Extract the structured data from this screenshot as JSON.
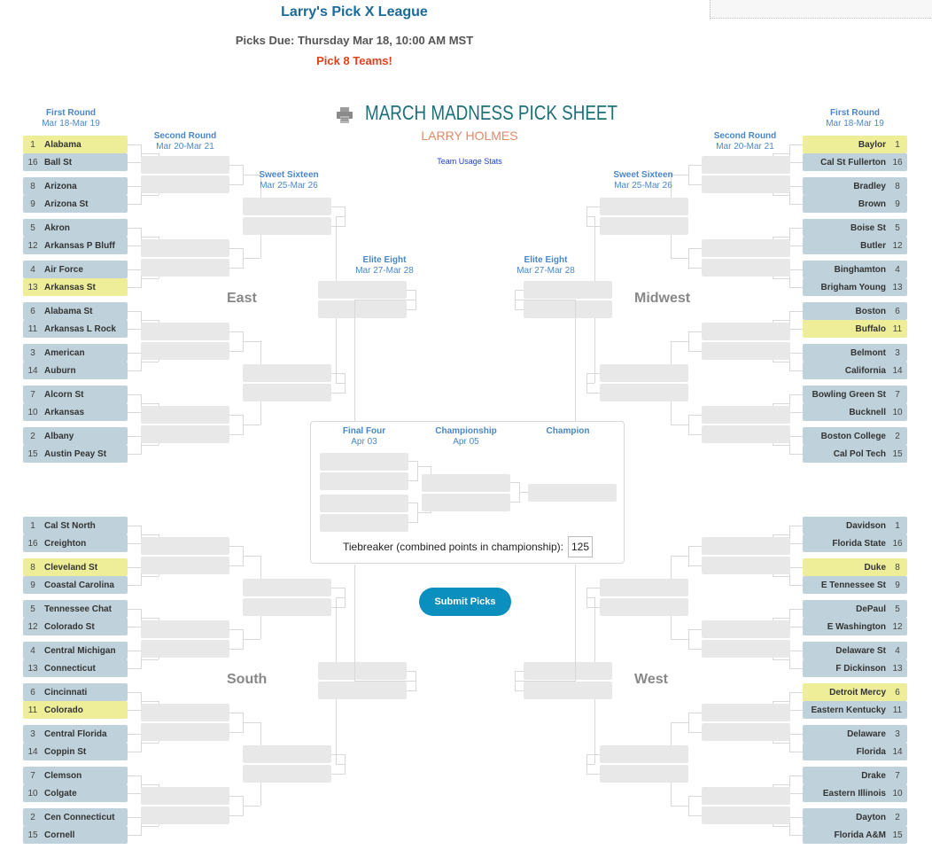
{
  "header": {
    "league_title": "Larry's Pick X League",
    "picks_due": "Picks Due: Thursday Mar 18, 10:00 AM MST",
    "pick_count": "Pick 8 Teams!",
    "sheet_title": "MARCH MADNESS PICK SHEET",
    "player_name": "LARRY HOLMES",
    "team_usage_link": "Team Usage Stats",
    "print_icon": "printer-icon"
  },
  "rounds": {
    "first": {
      "name": "First Round",
      "dates": "Mar 18-Mar 19"
    },
    "second": {
      "name": "Second Round",
      "dates": "Mar 20-Mar 21"
    },
    "sweet16": {
      "name": "Sweet Sixteen",
      "dates": "Mar 25-Mar 26"
    },
    "elite8": {
      "name": "Elite Eight",
      "dates": "Mar 27-Mar 28"
    },
    "final4": {
      "name": "Final Four",
      "dates": "Apr 03"
    },
    "championship": {
      "name": "Championship",
      "dates": "Apr 05"
    },
    "champion": {
      "name": "Champion"
    }
  },
  "regions": [
    {
      "name": "East",
      "side": "left",
      "teams": [
        {
          "seed": 1,
          "name": "Alabama",
          "picked": true
        },
        {
          "seed": 16,
          "name": "Ball St",
          "picked": false
        },
        {
          "seed": 8,
          "name": "Arizona",
          "picked": false
        },
        {
          "seed": 9,
          "name": "Arizona St",
          "picked": false
        },
        {
          "seed": 5,
          "name": "Akron",
          "picked": false
        },
        {
          "seed": 12,
          "name": "Arkansas P Bluff",
          "picked": false
        },
        {
          "seed": 4,
          "name": "Air Force",
          "picked": false
        },
        {
          "seed": 13,
          "name": "Arkansas St",
          "picked": true
        },
        {
          "seed": 6,
          "name": "Alabama St",
          "picked": false
        },
        {
          "seed": 11,
          "name": "Arkansas L Rock",
          "picked": false
        },
        {
          "seed": 3,
          "name": "American",
          "picked": false
        },
        {
          "seed": 14,
          "name": "Auburn",
          "picked": false
        },
        {
          "seed": 7,
          "name": "Alcorn St",
          "picked": false
        },
        {
          "seed": 10,
          "name": "Arkansas",
          "picked": false
        },
        {
          "seed": 2,
          "name": "Albany",
          "picked": false
        },
        {
          "seed": 15,
          "name": "Austin Peay St",
          "picked": false
        }
      ]
    },
    {
      "name": "Midwest",
      "side": "right",
      "teams": [
        {
          "seed": 1,
          "name": "Baylor",
          "picked": true
        },
        {
          "seed": 16,
          "name": "Cal St Fullerton",
          "picked": false
        },
        {
          "seed": 8,
          "name": "Bradley",
          "picked": false
        },
        {
          "seed": 9,
          "name": "Brown",
          "picked": false
        },
        {
          "seed": 5,
          "name": "Boise St",
          "picked": false
        },
        {
          "seed": 12,
          "name": "Butler",
          "picked": false
        },
        {
          "seed": 4,
          "name": "Binghamton",
          "picked": false
        },
        {
          "seed": 13,
          "name": "Brigham Young",
          "picked": false
        },
        {
          "seed": 6,
          "name": "Boston",
          "picked": false
        },
        {
          "seed": 11,
          "name": "Buffalo",
          "picked": true
        },
        {
          "seed": 3,
          "name": "Belmont",
          "picked": false
        },
        {
          "seed": 14,
          "name": "California",
          "picked": false
        },
        {
          "seed": 7,
          "name": "Bowling Green St",
          "picked": false
        },
        {
          "seed": 10,
          "name": "Bucknell",
          "picked": false
        },
        {
          "seed": 2,
          "name": "Boston College",
          "picked": false
        },
        {
          "seed": 15,
          "name": "Cal Pol Tech",
          "picked": false
        }
      ]
    },
    {
      "name": "South",
      "side": "left",
      "teams": [
        {
          "seed": 1,
          "name": "Cal St North",
          "picked": false
        },
        {
          "seed": 16,
          "name": "Creighton",
          "picked": false
        },
        {
          "seed": 8,
          "name": "Cleveland St",
          "picked": true
        },
        {
          "seed": 9,
          "name": "Coastal Carolina",
          "picked": false
        },
        {
          "seed": 5,
          "name": "Tennessee Chat",
          "picked": false
        },
        {
          "seed": 12,
          "name": "Colorado St",
          "picked": false
        },
        {
          "seed": 4,
          "name": "Central Michigan",
          "picked": false
        },
        {
          "seed": 13,
          "name": "Connecticut",
          "picked": false
        },
        {
          "seed": 6,
          "name": "Cincinnati",
          "picked": false
        },
        {
          "seed": 11,
          "name": "Colorado",
          "picked": true
        },
        {
          "seed": 3,
          "name": "Central Florida",
          "picked": false
        },
        {
          "seed": 14,
          "name": "Coppin St",
          "picked": false
        },
        {
          "seed": 7,
          "name": "Clemson",
          "picked": false
        },
        {
          "seed": 10,
          "name": "Colgate",
          "picked": false
        },
        {
          "seed": 2,
          "name": "Cen Connecticut",
          "picked": false
        },
        {
          "seed": 15,
          "name": "Cornell",
          "picked": false
        }
      ]
    },
    {
      "name": "West",
      "side": "right",
      "teams": [
        {
          "seed": 1,
          "name": "Davidson",
          "picked": false
        },
        {
          "seed": 16,
          "name": "Florida State",
          "picked": false
        },
        {
          "seed": 8,
          "name": "Duke",
          "picked": true
        },
        {
          "seed": 9,
          "name": "E Tennessee St",
          "picked": false
        },
        {
          "seed": 5,
          "name": "DePaul",
          "picked": false
        },
        {
          "seed": 12,
          "name": "E Washington",
          "picked": false
        },
        {
          "seed": 4,
          "name": "Delaware St",
          "picked": false
        },
        {
          "seed": 13,
          "name": "F Dickinson",
          "picked": false
        },
        {
          "seed": 6,
          "name": "Detroit Mercy",
          "picked": true
        },
        {
          "seed": 11,
          "name": "Eastern Kentucky",
          "picked": false
        },
        {
          "seed": 3,
          "name": "Delaware",
          "picked": false
        },
        {
          "seed": 14,
          "name": "Florida",
          "picked": false
        },
        {
          "seed": 7,
          "name": "Drake",
          "picked": false
        },
        {
          "seed": 10,
          "name": "Eastern Illinois",
          "picked": false
        },
        {
          "seed": 2,
          "name": "Dayton",
          "picked": false
        },
        {
          "seed": 15,
          "name": "Florida A&M",
          "picked": false
        }
      ]
    }
  ],
  "finals": {
    "tiebreaker_label": "Tiebreaker (combined points in championship):",
    "tiebreaker_value": "125"
  },
  "actions": {
    "submit_label": "Submit Picks"
  },
  "colors": {
    "picked": "#eeee99",
    "team": "#bfd2db",
    "empty_slot": "#e8e8e8",
    "accent": "#0b8fbf",
    "round_header": "#4a87c8"
  }
}
